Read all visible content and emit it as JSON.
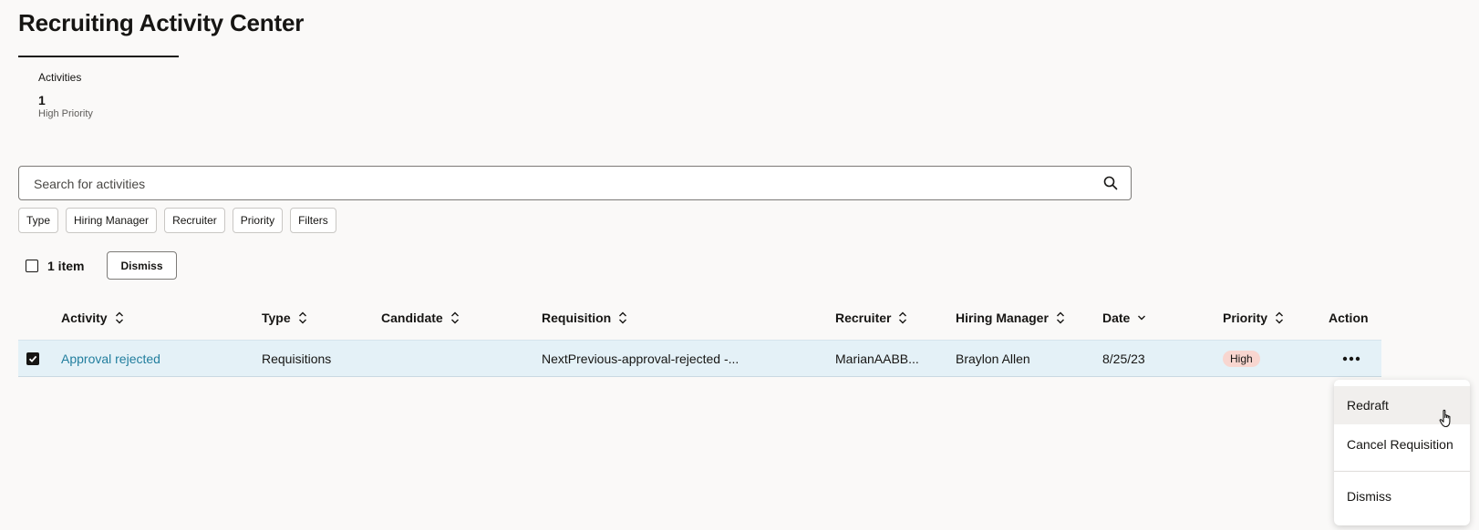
{
  "page": {
    "title": "Recruiting Activity Center"
  },
  "stats": {
    "label": "Activities",
    "value": "1",
    "sub": "High Priority"
  },
  "search": {
    "placeholder": "Search for activities"
  },
  "filters": [
    "Type",
    "Hiring Manager",
    "Recruiter",
    "Priority",
    "Filters"
  ],
  "selection": {
    "count_label": "1 item",
    "dismiss_label": "Dismiss"
  },
  "table": {
    "columns": [
      "Activity",
      "Type",
      "Candidate",
      "Requisition",
      "Recruiter",
      "Hiring Manager",
      "Date",
      "Priority",
      "Action"
    ],
    "rows": [
      {
        "activity": "Approval rejected",
        "type": "Requisitions",
        "candidate": "",
        "requisition": "NextPrevious-approval-rejected -...",
        "recruiter": "MarianAABB...",
        "hiring_manager": "Braylon Allen",
        "date": "8/25/23",
        "priority": "High",
        "selected": true
      }
    ]
  },
  "action_menu": {
    "items": [
      "Redraft",
      "Cancel Requisition",
      "Dismiss"
    ]
  },
  "colors": {
    "link": "#227e9e",
    "row_selected": "#e4f1f7",
    "priority_high": "#f8d6d0"
  }
}
